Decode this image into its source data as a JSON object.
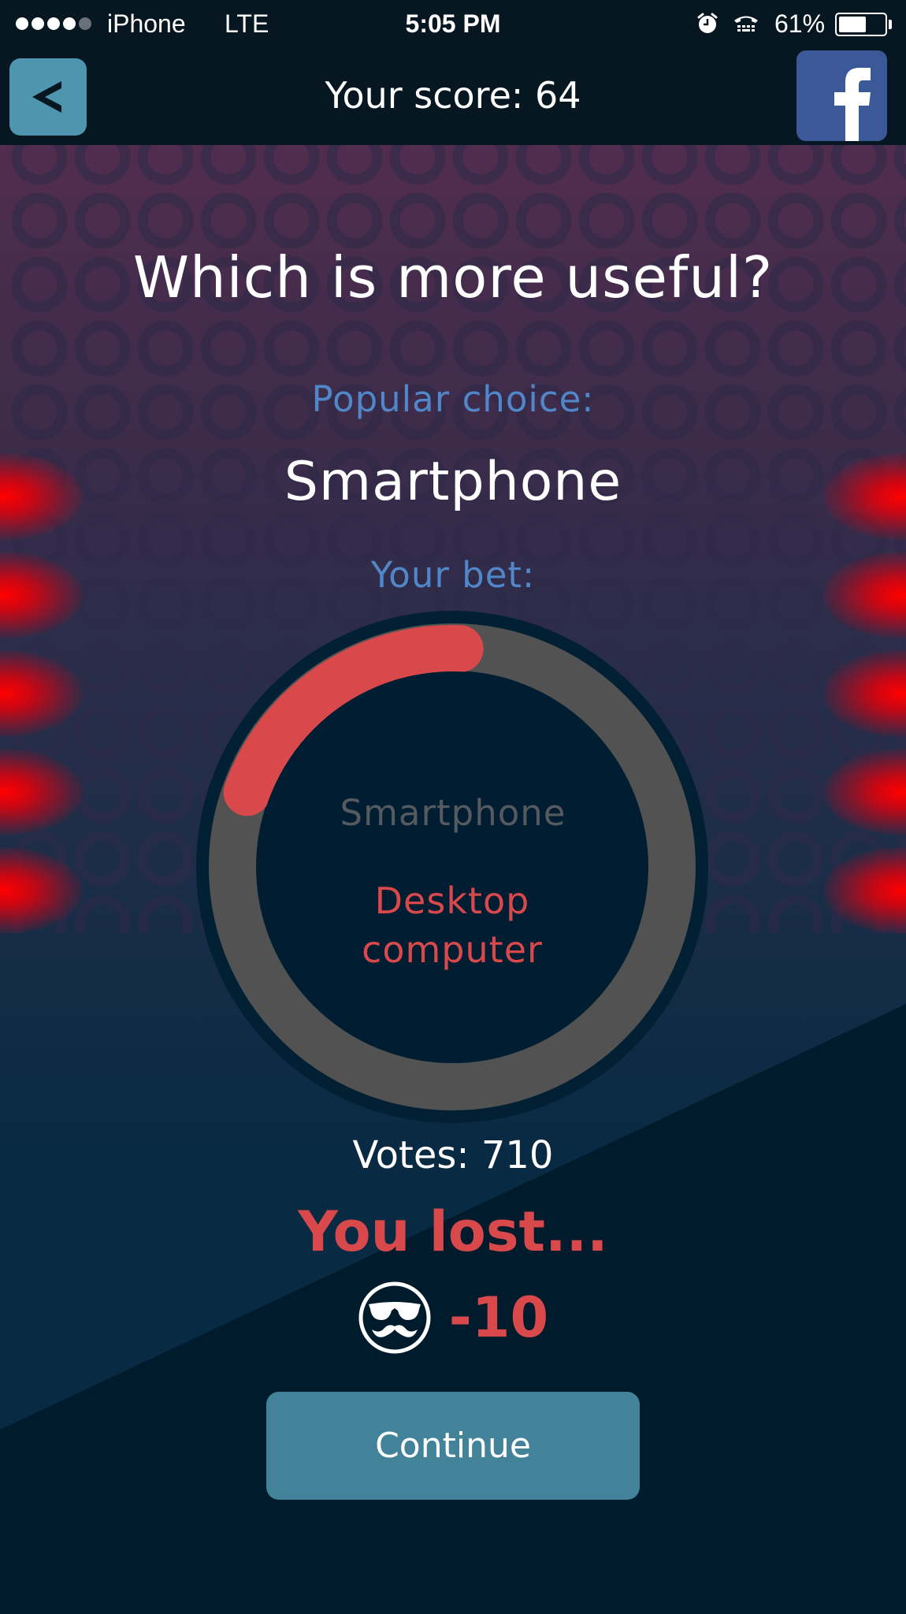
{
  "status_bar": {
    "signal_bars_filled": 4,
    "signal_bars_total": 5,
    "carrier": "iPhone",
    "network": "LTE",
    "time": "5:05 PM",
    "icons": [
      "alarm-icon",
      "tty-icon"
    ],
    "battery_percent_text": "61%",
    "battery_level": 0.61
  },
  "header": {
    "back_icon": "chevron-left-icon",
    "score_text": "Your score: 64",
    "share_icon": "facebook-icon"
  },
  "question": "Which is more useful?",
  "popular": {
    "label": "Popular choice:",
    "value": "Smartphone"
  },
  "bet": {
    "label": "Your bet:"
  },
  "ring": {
    "top_option": "Smartphone",
    "bet_option": "Desktop computer",
    "bet_share": 0.2,
    "colors": {
      "track": "#525252",
      "arc": "#d9494c",
      "outer": "#022033",
      "inner": "#001d31"
    }
  },
  "votes_text": "Votes: 710",
  "result": {
    "text": "You lost...",
    "icon": "mustache-glasses-icon",
    "delta": "-10"
  },
  "continue_label": "Continue",
  "colors": {
    "accent_red": "#d9494c",
    "label_blue": "#5187c9",
    "button_teal": "#428399",
    "back_button": "#4e95b0",
    "facebook_blue": "#3b5998"
  }
}
